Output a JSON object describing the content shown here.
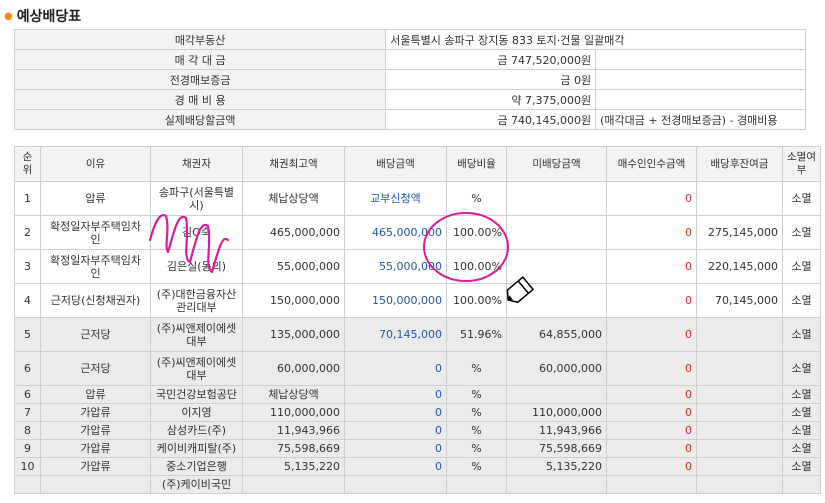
{
  "title": "예상배당표",
  "summary": [
    {
      "label": "매각부동산",
      "value": "서울특별시 송파구 장지동 833   토지·건물 일괄매각",
      "note": ""
    },
    {
      "label": "매 각 대 금",
      "value": "금 747,520,000원",
      "note": ""
    },
    {
      "label": "전경매보증금",
      "value": "금 0원",
      "note": ""
    },
    {
      "label": "경 매 비 용",
      "value": "약 7,375,000원",
      "note": ""
    },
    {
      "label": "실제배당할금액",
      "value": "금 740,145,000원",
      "note": "(매각대금 + 전경매보증금) - 경매비용"
    }
  ],
  "headers": {
    "no": "순위",
    "reason": "이유",
    "creditor": "채권자",
    "max_amount": "채권최고액",
    "dividend": "배당금액",
    "ratio": "배당비율",
    "unpaid": "미배당금액",
    "assume": "매수인인수금액",
    "remaining": "배당후잔여금",
    "extinct": "소멸여부"
  },
  "rows": [
    {
      "no": "1",
      "reason": "압류",
      "creditor": "송파구(서울특별시)",
      "max": "체납상당액",
      "div": "교부신청액",
      "ratio": "%",
      "unpaid": "",
      "assume": "0",
      "remain": "",
      "ext": "소멸",
      "style": "white"
    },
    {
      "no": "2",
      "reason": "확정일자부주택임차인",
      "creditor": "김O숙",
      "max": "465,000,000",
      "div": "465,000,000",
      "ratio": "100.00%",
      "unpaid": "",
      "assume": "0",
      "remain": "275,145,000",
      "ext": "소멸",
      "style": "white"
    },
    {
      "no": "3",
      "reason": "확정일자부주택임차인",
      "creditor": "김은실(동의)",
      "max": "55,000,000",
      "div": "55,000,000",
      "ratio": "100.00%",
      "unpaid": "",
      "assume": "0",
      "remain": "220,145,000",
      "ext": "소멸",
      "style": "white"
    },
    {
      "no": "4",
      "reason": "근저당(신청채권자)",
      "creditor": "(주)대한금융자산관리대부",
      "max": "150,000,000",
      "div": "150,000,000",
      "ratio": "100.00%",
      "unpaid": "",
      "assume": "0",
      "remain": "70,145,000",
      "ext": "소멸",
      "style": "white"
    },
    {
      "no": "5",
      "reason": "근저당",
      "creditor": "(주)씨앤제이에셋대부",
      "max": "135,000,000",
      "div": "70,145,000",
      "ratio": "51.96%",
      "unpaid": "64,855,000",
      "assume": "0",
      "remain": "",
      "ext": "소멸",
      "style": "gray"
    },
    {
      "no": "6",
      "reason": "근저당",
      "creditor": "(주)씨앤제이에셋대부",
      "max": "60,000,000",
      "div": "0",
      "ratio": "%",
      "unpaid": "60,000,000",
      "assume": "0",
      "remain": "",
      "ext": "소멸",
      "style": "gray"
    },
    {
      "no": "6",
      "reason": "압류",
      "creditor": "국민건강보험공단",
      "max": "체납상당액",
      "div": "0",
      "ratio": "%",
      "unpaid": "",
      "assume": "0",
      "remain": "",
      "ext": "소멸",
      "style": "gray",
      "short": true
    },
    {
      "no": "7",
      "reason": "가압류",
      "creditor": "이지영",
      "max": "110,000,000",
      "div": "0",
      "ratio": "%",
      "unpaid": "110,000,000",
      "assume": "0",
      "remain": "",
      "ext": "소멸",
      "style": "gray",
      "short": true
    },
    {
      "no": "8",
      "reason": "가압류",
      "creditor": "삼성카드(주)",
      "max": "11,943,966",
      "div": "0",
      "ratio": "%",
      "unpaid": "11,943,966",
      "assume": "0",
      "remain": "",
      "ext": "소멸",
      "style": "gray",
      "short": true
    },
    {
      "no": "9",
      "reason": "가압류",
      "creditor": "케이비캐피탈(주)",
      "max": "75,598,669",
      "div": "0",
      "ratio": "%",
      "unpaid": "75,598,669",
      "assume": "0",
      "remain": "",
      "ext": "소멸",
      "style": "gray",
      "short": true
    },
    {
      "no": "10",
      "reason": "가압류",
      "creditor": "중소기업은행",
      "max": "5,135,220",
      "div": "0",
      "ratio": "%",
      "unpaid": "5,135,220",
      "assume": "0",
      "remain": "",
      "ext": "소멸",
      "style": "gray",
      "short": true
    },
    {
      "no": "",
      "reason": "",
      "creditor": "(주)케이비국민",
      "max": "",
      "div": "",
      "ratio": "",
      "unpaid": "",
      "assume": "",
      "remain": "",
      "ext": "",
      "style": "gray",
      "short": true
    }
  ],
  "colors": {
    "annotation": "#d81d9a",
    "blue": "#2456a8",
    "red": "#d52b2b",
    "header_bg": "#f3f3f3",
    "gray_row": "#ebebeb"
  },
  "icons": {
    "cursor": "pencil-cursor-icon"
  }
}
